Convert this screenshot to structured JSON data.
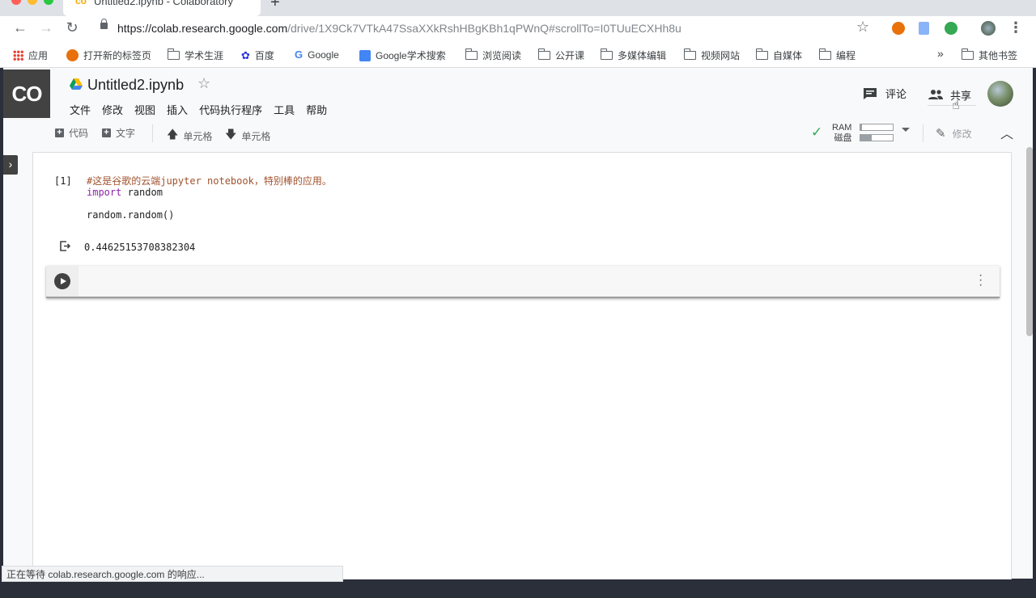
{
  "browser": {
    "tab_title": "Untitled2.ipynb - Colaboratory",
    "url_host": "https://colab.research.google.com",
    "url_path": "/drive/1X9Ck7VTkA47SsaXXkRshHBgKBh1qPWnQ#scrollTo=I0TUuECXHh8u",
    "bookmarks": [
      "应用",
      "打开新的标签页",
      "学术生涯",
      "百度",
      "Google",
      "Google学术搜索",
      "浏览阅读",
      "公开课",
      "多媒体编辑",
      "视频网站",
      "自媒体",
      "编程"
    ],
    "bookmarks_more": "»",
    "other_bookmarks": "其他书签",
    "status": "正在等待 colab.research.google.com 的响应..."
  },
  "colab": {
    "logo": "CO",
    "title": "Untitled2.ipynb",
    "menu": [
      "文件",
      "修改",
      "视图",
      "插入",
      "代码执行程序",
      "工具",
      "帮助"
    ],
    "comment": "评论",
    "share": "共享",
    "toolbar": {
      "add_code": "代码",
      "add_text": "文字",
      "cell_up": "单元格",
      "cell_down": "单元格",
      "ram_label": "RAM",
      "disk_label": "磁盘",
      "ram_usage": 0.05,
      "disk_usage": 0.35,
      "edit": "修改"
    },
    "cell": {
      "exec_count": "[1]",
      "comment_line": "#这是谷歌的云端jupyter notebook，特别棒的应用。",
      "import_kw": "import",
      "import_mod": " random",
      "call_line": "random.random()",
      "output": "0.44625153708382304"
    }
  }
}
